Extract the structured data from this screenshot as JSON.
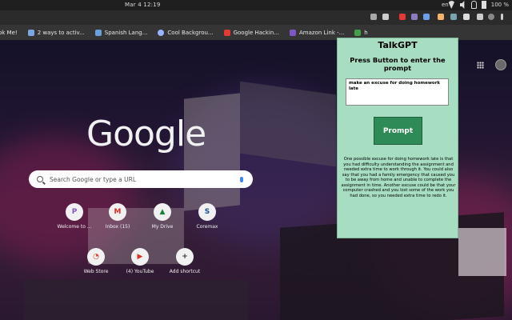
{
  "system": {
    "clock": "Mar 4  12:19",
    "language": "en",
    "battery": "100 %"
  },
  "bookmarks": [
    {
      "label": "ok Me!",
      "icon": "bookmark-icon",
      "color": "#4a6fa5"
    },
    {
      "label": "2 ways to activ...",
      "icon": "page-icon",
      "color": "#7aa7e0"
    },
    {
      "label": "Spanish Lang...",
      "icon": "page-icon",
      "color": "#6aa1d8"
    },
    {
      "label": "Cool Backgrou...",
      "icon": "globe-icon",
      "color": "#9ab3ff"
    },
    {
      "label": "Google Hackin...",
      "icon": "youtube-icon",
      "color": "#e53935"
    },
    {
      "label": "Amazon Link -...",
      "icon": "purple-icon",
      "color": "#7e57c2"
    },
    {
      "label": "h",
      "icon": "green-icon",
      "color": "#43a047"
    }
  ],
  "newtab": {
    "logo": "Google",
    "search_placeholder": "Search Google or type a URL",
    "shortcuts": [
      {
        "label": "Welcome to ...",
        "glyph": "P",
        "color": "#7e57c2"
      },
      {
        "label": "Inbox (15)",
        "glyph": "M",
        "color": "#d93025"
      },
      {
        "label": "My Drive",
        "glyph": "▲",
        "color": "#188038"
      },
      {
        "label": "Coremax",
        "glyph": "S",
        "color": "#1a4fa0"
      },
      {
        "label": "Web Store",
        "glyph": "◔",
        "color": "#db4437"
      },
      {
        "label": "(4) YouTube",
        "glyph": "▶",
        "color": "#e52d27"
      },
      {
        "label": "Add shortcut",
        "glyph": "+",
        "color": "#333333"
      }
    ]
  },
  "popup": {
    "title": "TalkGPT",
    "subtitle": "Press Button to enter the prompt",
    "prompt_value": "make an excuse for doing homework late",
    "button_label": "Prompt",
    "answer": "One possible excuse for doing homework late is that you had difficulty understanding the assignment and needed extra time to work through it. You could also say that you had a family emergency that caused you to be away from home and unable to complete the assignment in time. Another excuse could be that your computer crashed and you lost some of the work you had done, so you needed extra time to redo it.",
    "background": "#a7ddc0",
    "button_color": "#2e8b57"
  }
}
